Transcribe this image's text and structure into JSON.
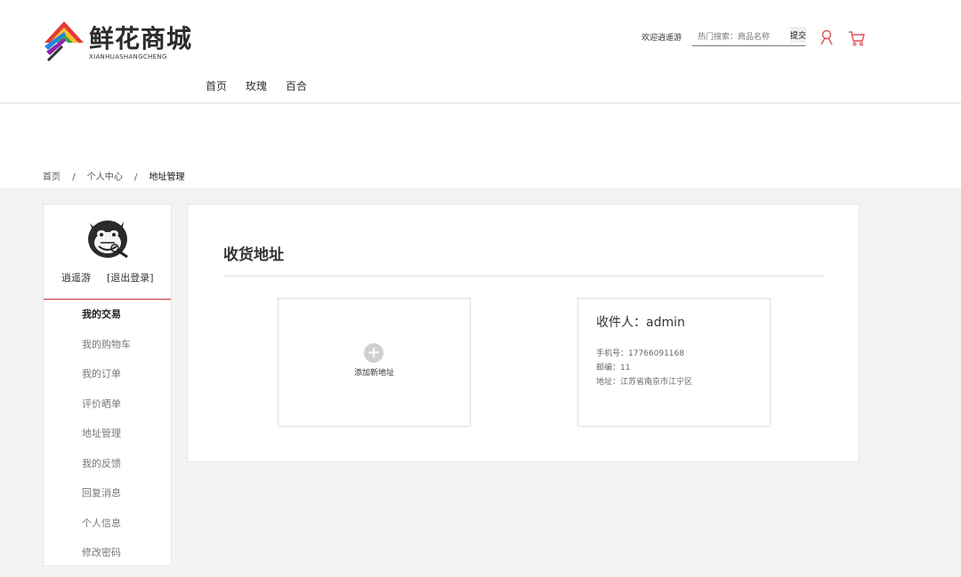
{
  "brand": {
    "title": "鲜花商城",
    "subtitle": "XIANHUASHANGCHENG"
  },
  "nav": [
    "首页",
    "玫瑰",
    "百合"
  ],
  "topbar": {
    "welcome": "欢迎逍遥游",
    "search_placeholder": "热门搜索：商品名称",
    "submit_label": "提交"
  },
  "breadcrumb": {
    "items": [
      "首页",
      "个人中心"
    ],
    "separator": "/",
    "current": "地址管理"
  },
  "profile": {
    "username": "逍遥游",
    "logout": "[退出登录]"
  },
  "menu": [
    {
      "label": "我的交易",
      "heading": true
    },
    {
      "label": "我的购物车"
    },
    {
      "label": "我的订单"
    },
    {
      "label": "评价晒单"
    },
    {
      "label": "地址管理"
    },
    {
      "label": "我的反馈"
    },
    {
      "label": "回复消息"
    },
    {
      "label": "个人信息"
    },
    {
      "label": "修改密码"
    }
  ],
  "content": {
    "title": "收货地址",
    "add_icon": "plus-circle-icon",
    "add_label": "添加新地址",
    "address": {
      "recipient": "收件人：admin",
      "phone": "手机号：17766091168",
      "zip": "邮编：11",
      "address": "地址：江苏省南京市江宁区"
    }
  },
  "colors": {
    "accent": "#c9343a",
    "cart_icon": "#d9534f",
    "page_bg": "#f3f3f3"
  }
}
